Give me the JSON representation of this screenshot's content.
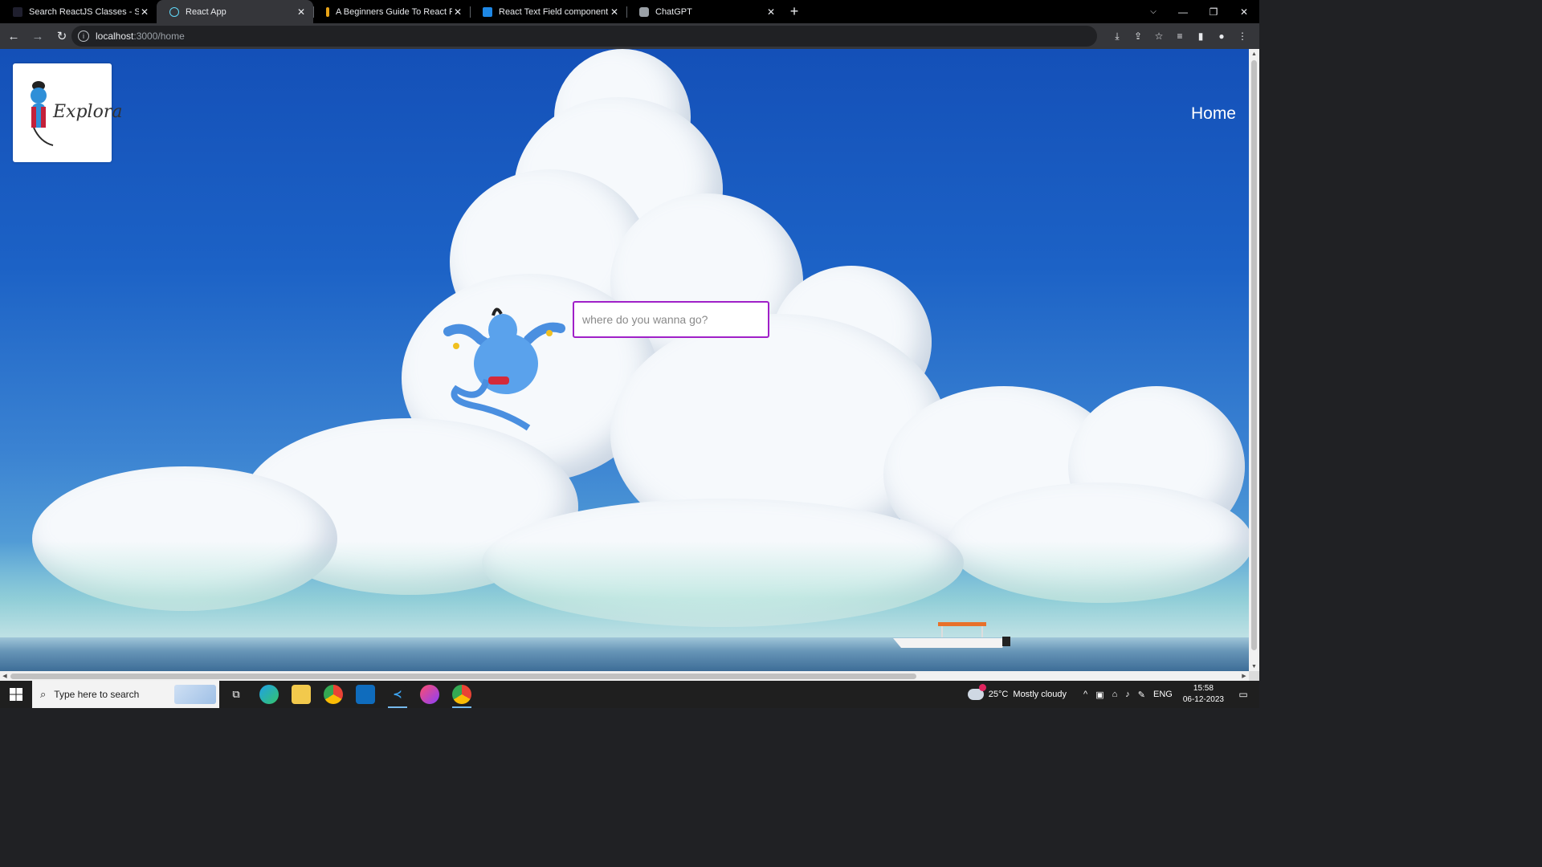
{
  "browser": {
    "tabs": [
      {
        "title": "Search ReactJS Classes - Skillsha",
        "favicon_color": "#1f1f2e",
        "active": false
      },
      {
        "title": "React App",
        "favicon_color": "#61dafb",
        "active": true
      },
      {
        "title": "A Beginners Guide To React Prop",
        "favicon_color": "#e8a317",
        "active": false
      },
      {
        "title": "React Text Field component - M",
        "favicon_color": "#1e88e5",
        "active": false
      },
      {
        "title": "ChatGPT",
        "favicon_color": "#9aa0a6",
        "active": false
      }
    ],
    "url_host": "localhost",
    "url_path": ":3000/home"
  },
  "page": {
    "logo_text": "Explora",
    "nav_home": "Home",
    "search_placeholder": "where do you wanna go?"
  },
  "taskbar": {
    "search_placeholder": "Type here to search",
    "weather_temp": "25°C",
    "weather_desc": "Mostly cloudy",
    "language": "ENG",
    "time": "15:58",
    "date": "06-12-2023"
  },
  "colors": {
    "search_border": "#a020c8",
    "sky_top": "#1450b8",
    "taskbar_bg": "#1f1f1f"
  }
}
